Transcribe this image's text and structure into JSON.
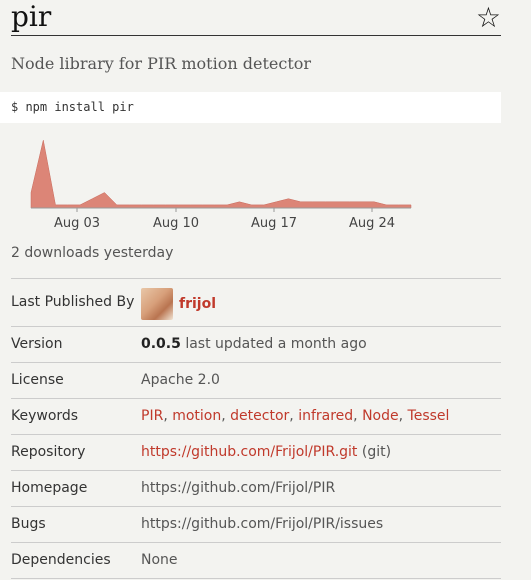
{
  "package": {
    "name": "pir",
    "description": "Node library for PIR motion detector",
    "install_command": "$ npm install pir"
  },
  "colors": {
    "accent": "#c0392b",
    "chart_fill": "#dc8577",
    "background": "#f3f3f0"
  },
  "chart_data": {
    "type": "area",
    "x_labels": [
      "Aug 03",
      "Aug 10",
      "Aug 17",
      "Aug 24"
    ],
    "values": [
      5,
      22,
      1,
      1,
      1,
      3,
      5,
      1,
      1,
      1,
      1,
      1,
      1,
      1,
      1,
      1,
      1,
      2,
      1,
      1,
      2,
      3,
      2,
      2,
      2,
      2,
      2,
      2,
      2,
      1,
      1,
      1
    ],
    "ylim": [
      0,
      22
    ],
    "series": [
      {
        "name": "",
        "values": [
          5,
          22,
          1,
          1,
          1,
          3,
          5,
          1,
          1,
          1,
          1,
          1,
          1,
          1,
          1,
          1,
          1,
          2,
          1,
          1,
          2,
          3,
          2,
          2,
          2,
          2,
          2,
          2,
          2,
          1,
          1,
          1
        ]
      }
    ]
  },
  "downloads": {
    "text": "2 downloads yesterday"
  },
  "meta": {
    "last_published_by": {
      "label": "Last Published By",
      "user": "frijol"
    },
    "version": {
      "label": "Version",
      "number": "0.0.5",
      "updated": "last updated a month ago"
    },
    "license": {
      "label": "License",
      "value": "Apache 2.0"
    },
    "keywords": {
      "label": "Keywords",
      "items": [
        "PIR",
        "motion",
        "detector",
        "infrared",
        "Node",
        "Tessel"
      ]
    },
    "repository": {
      "label": "Repository",
      "url": "https://github.com/Frijol/PIR.git",
      "suffix": "(git)"
    },
    "homepage": {
      "label": "Homepage",
      "url": "https://github.com/Frijol/PIR"
    },
    "bugs": {
      "label": "Bugs",
      "url": "https://github.com/Frijol/PIR/issues"
    },
    "dependencies": {
      "label": "Dependencies",
      "value": "None"
    }
  },
  "icons": {
    "star": "star-outline-icon"
  }
}
